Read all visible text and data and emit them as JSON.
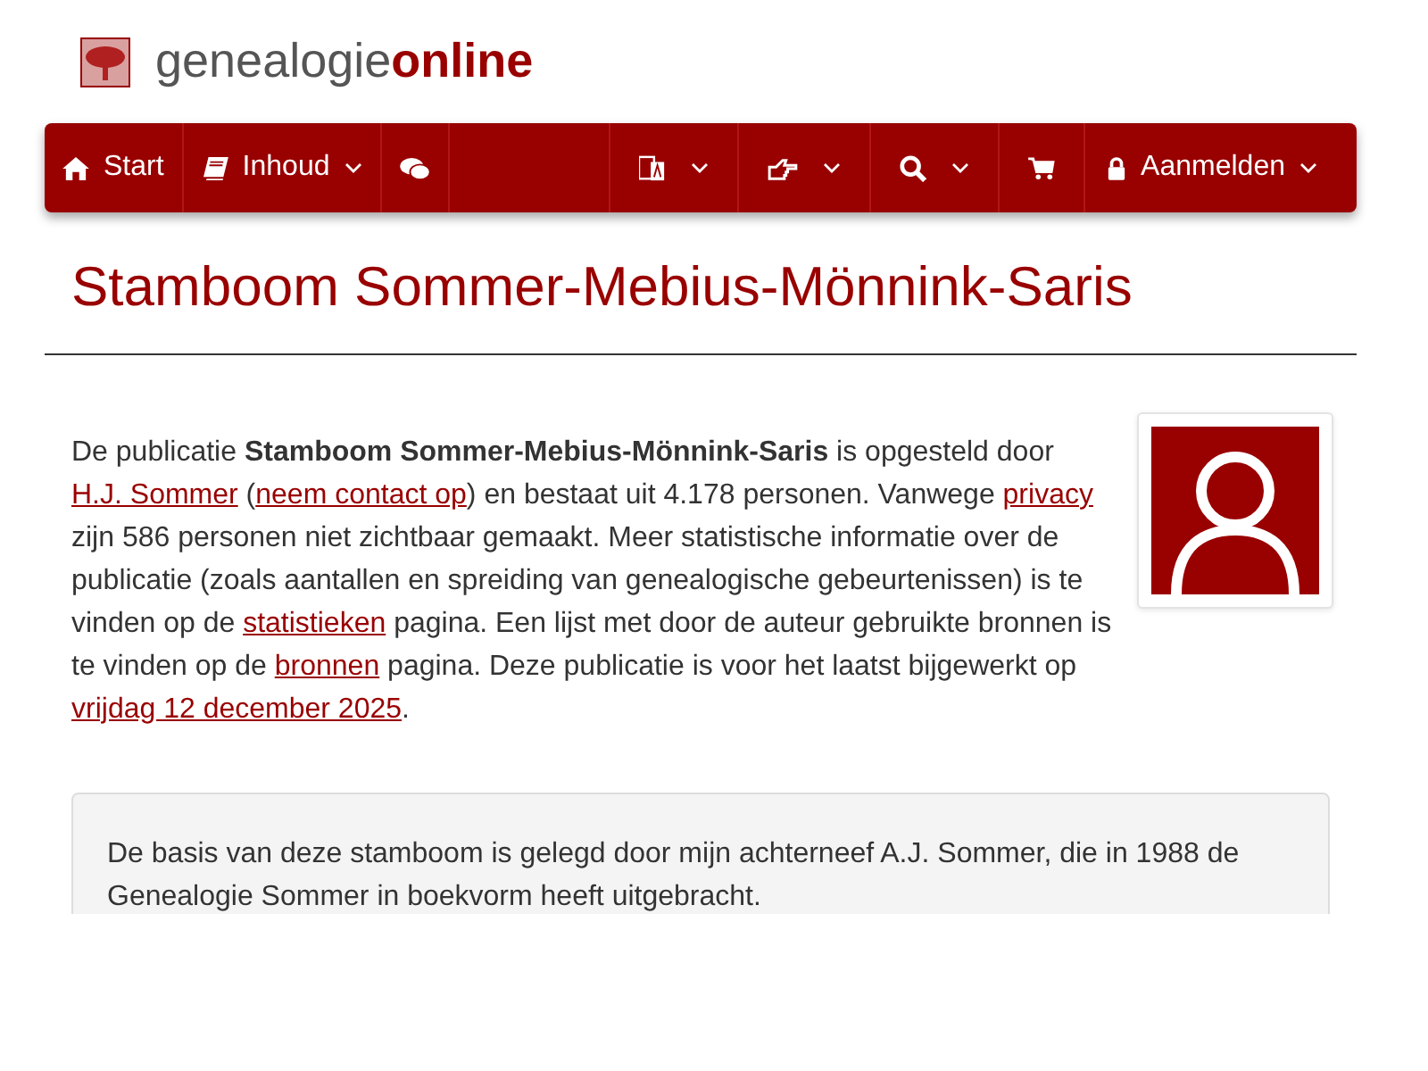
{
  "logo": {
    "text_regular": "genealogie",
    "text_bold": "online"
  },
  "nav": {
    "left": [
      {
        "label": "Start",
        "caret": false
      },
      {
        "label": "Inhoud",
        "caret": true
      },
      {
        "caret": false
      }
    ],
    "right": [
      {
        "caret": true
      },
      {
        "caret": true
      },
      {
        "caret": true
      },
      {
        "caret": false
      },
      {
        "label": "Aanmelden",
        "caret": true
      }
    ]
  },
  "title": "Stamboom Sommer-Mebius-Mönnink-Saris",
  "intro": [
    {
      "kind": "text",
      "text": "De publicatie "
    },
    {
      "kind": "bold",
      "text": "Stamboom Sommer-Mebius-Mönnink-Saris"
    },
    {
      "kind": "text",
      "text": " is opgesteld door "
    },
    {
      "kind": "link",
      "text": "H.J. Sommer"
    },
    {
      "kind": "text",
      "text": " ("
    },
    {
      "kind": "link",
      "text": "neem contact op"
    },
    {
      "kind": "text",
      "text": ") en bestaat uit 4.178 personen. Vanwege "
    },
    {
      "kind": "link",
      "text": "privacy"
    },
    {
      "kind": "text",
      "text": " zijn 586 personen niet zichtbaar gemaakt. Meer statistische informatie over de publicatie (zoals aantallen en spreiding van genealogische gebeurtenissen) is te vinden op de "
    },
    {
      "kind": "link",
      "text": "statistieken"
    },
    {
      "kind": "text",
      "text": " pagina. Een lijst met door de auteur gebruikte bronnen is te vinden op de "
    },
    {
      "kind": "link",
      "text": "bronnen"
    },
    {
      "kind": "text",
      "text": " pagina. Deze publicatie is voor het laatst bijgewerkt op "
    },
    {
      "kind": "link",
      "text": "vrijdag 12 december 2025"
    },
    {
      "kind": "text",
      "text": "."
    }
  ],
  "note": "De basis van deze stamboom is gelegd door mijn achterneef A.J. Sommer, die in 1988 de Genealogie Sommer in boekvorm heeft uitgebracht."
}
